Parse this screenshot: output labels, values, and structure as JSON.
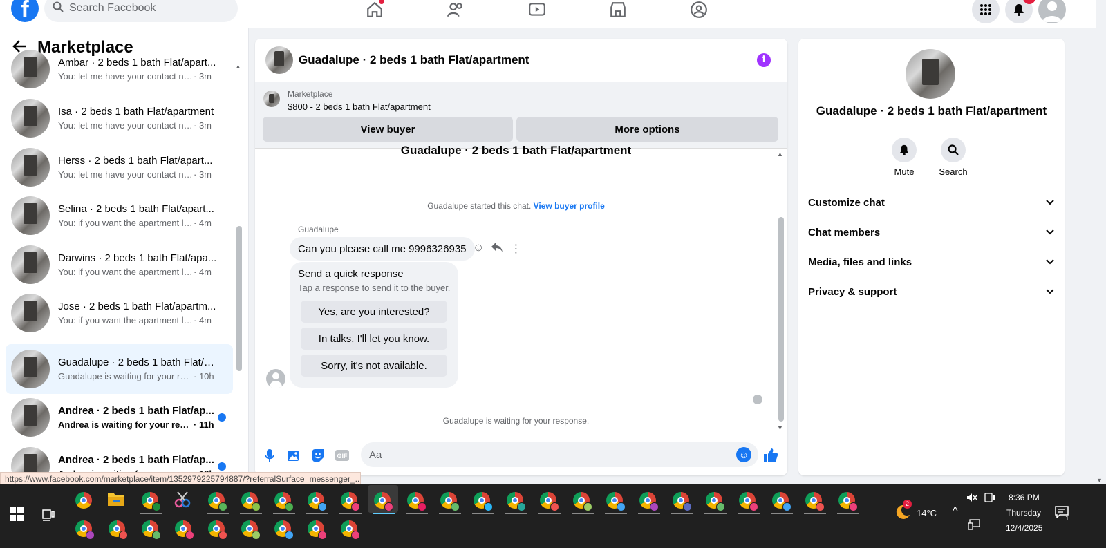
{
  "topbar": {
    "logo": "f",
    "search_placeholder": "Search Facebook",
    "nav_icons": [
      "home-icon",
      "friends-icon",
      "watch-icon",
      "marketplace-icon",
      "groups-icon"
    ],
    "notifications_badge": "9"
  },
  "left": {
    "title": "Marketplace",
    "conversations": [
      {
        "name": "Ambar · 2 beds 1 bath Flat/apart...",
        "preview": "You: let me have your contact num...",
        "time": "· 3m",
        "unread": false,
        "active": false
      },
      {
        "name": "Isa · 2 beds 1 bath Flat/apartment",
        "preview": "You: let me have your contact num...",
        "time": "· 3m",
        "unread": false,
        "active": false
      },
      {
        "name": "Herss · 2 beds 1 bath Flat/apart...",
        "preview": "You: let me have your contact num...",
        "time": "· 3m",
        "unread": false,
        "active": false
      },
      {
        "name": "Selina · 2 beds 1 bath Flat/apart...",
        "preview": "You: if you want the apartment let ...",
        "time": "· 4m",
        "unread": false,
        "active": false
      },
      {
        "name": "Darwins · 2 beds 1 bath Flat/apa...",
        "preview": "You: if you want the apartment let ...",
        "time": "· 4m",
        "unread": false,
        "active": false
      },
      {
        "name": "Jose · 2 beds 1 bath Flat/apartm...",
        "preview": "You: if you want the apartment let ...",
        "time": "· 4m",
        "unread": false,
        "active": false
      },
      {
        "name": "Guadalupe · 2 beds 1 bath Flat/a...",
        "preview": "Guadalupe is waiting for your res...",
        "time": "· 10h",
        "unread": false,
        "active": true
      },
      {
        "name": "Andrea · 2 beds 1 bath Flat/ap...",
        "preview": "Andrea is waiting for your resp...",
        "time": "· 11h",
        "unread": true,
        "active": false
      },
      {
        "name": "Andrea · 2 beds 1 bath Flat/ap...",
        "preview": "Andrea is waiting for your resp...",
        "time": "· 12h",
        "unread": true,
        "active": false
      }
    ]
  },
  "chat": {
    "title": "Guadalupe · 2 beds 1 bath Flat/apartment",
    "banner": {
      "label": "Marketplace",
      "listing": "$800 - 2 beds 1 bath Flat/apartment",
      "view_buyer": "View buyer",
      "more_options": "More options"
    },
    "cut_title": "Guadalupe · 2 beds 1 bath Flat/apartment",
    "started_text": "Guadalupe started this chat.",
    "view_profile": "View buyer profile",
    "sender": "Guadalupe",
    "message": "Can you please call me 9996326935",
    "quick": {
      "title": "Send a quick response",
      "subtitle": "Tap a response to send it to the buyer.",
      "options": [
        "Yes, are you interested?",
        "In talks. I'll let you know.",
        "Sorry, it's not available."
      ]
    },
    "waiting": "Guadalupe is waiting for your response.",
    "composer_placeholder": "Aa"
  },
  "right": {
    "title": "Guadalupe · 2 beds 1 bath Flat/apartment",
    "mute": "Mute",
    "search": "Search",
    "sections": [
      "Customize chat",
      "Chat members",
      "Media, files and links",
      "Privacy & support"
    ]
  },
  "status_url": "https://www.facebook.com/marketplace/item/1352979225794887/?referralSurface=messenger_...",
  "taskbar": {
    "weather_temp": "14°C",
    "time": "8:36 PM",
    "day": "Thursday",
    "date": "12/4/2025",
    "notif_count": "1",
    "weather_badge": "2"
  },
  "colors": {
    "accent": "#1877f2",
    "active_row": "#ebf5ff",
    "info": "#a033ff"
  }
}
